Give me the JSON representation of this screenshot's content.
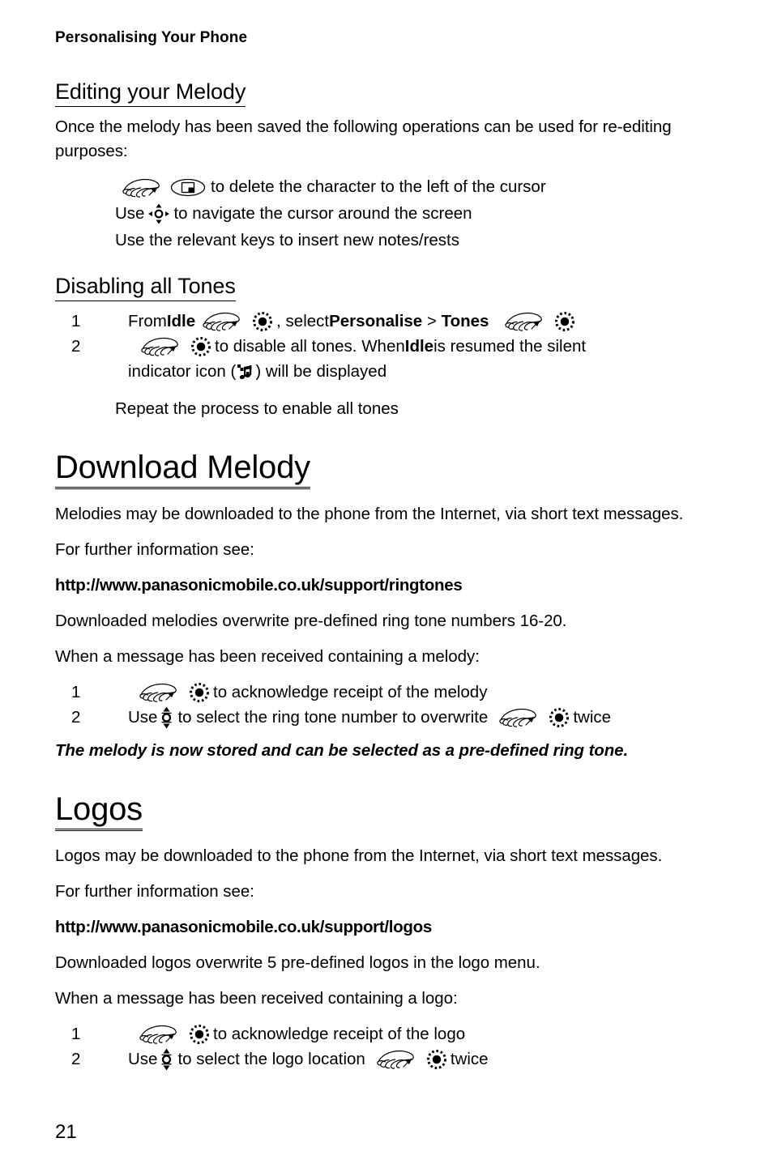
{
  "page": {
    "running_head": "Personalising Your Phone",
    "page_number": "21"
  },
  "icons": {
    "hand": "pointing-hand-icon",
    "select": "select-key-icon",
    "clear": "clear-key-icon",
    "nav4": "four-way-navigation-icon",
    "nav2": "up-down-navigation-icon",
    "silent": "silent-indicator-icon"
  },
  "sections": {
    "editing_melody": {
      "heading": "Editing your Melody",
      "intro": "Once the melody has been saved the following operations can be used for re-editing purposes:",
      "line1_text": "to delete the character to the left of the cursor",
      "line2_prefix": "Use",
      "line2_text": "to navigate the cursor around the screen",
      "line3": "Use the relevant keys to insert new notes/rests"
    },
    "disabling_tones": {
      "heading": "Disabling all Tones",
      "steps": [
        {
          "num": "1",
          "t1": "From ",
          "b1": "Idle",
          "t2": ", select ",
          "b2": "Personalise",
          "t3": " > ",
          "b3": "Tones"
        },
        {
          "num": "2",
          "t1": "to disable all tones. When ",
          "b1": "Idle",
          "t2": " is resumed the silent",
          "sub_pre": "indicator icon (",
          "sub_post": ") will be displayed"
        }
      ],
      "repeat": "Repeat the process to enable all tones"
    },
    "download_melody": {
      "heading": "Download Melody",
      "p1": "Melodies may be downloaded to the phone from the Internet, via short text messages.",
      "p2": "For further information see:",
      "url": "http://www.panasonicmobile.co.uk/support/ringtones",
      "p3": "Downloaded melodies overwrite pre-defined ring tone numbers 16-20.",
      "p4": "When a message has been received containing a melody:",
      "steps": [
        {
          "num": "1",
          "t1": "to acknowledge receipt of the melody"
        },
        {
          "num": "2",
          "t1": "Use",
          "t2": "to select the ring tone number to overwrite",
          "t3": "twice"
        }
      ],
      "note": "The melody is now stored and can be selected as a pre-defined ring tone."
    },
    "logos": {
      "heading": "Logos",
      "p1": "Logos may be downloaded to the phone from the Internet, via short text messages.",
      "p2": "For further information see:",
      "url": "http://www.panasonicmobile.co.uk/support/logos",
      "p3": "Downloaded logos overwrite 5 pre-defined logos in the logo menu.",
      "p4": "When a message has been received containing a logo:",
      "steps": [
        {
          "num": "1",
          "t1": "to acknowledge receipt of the logo"
        },
        {
          "num": "2",
          "t1": "Use",
          "t2": "to select the logo location",
          "t3": "twice"
        }
      ]
    }
  }
}
